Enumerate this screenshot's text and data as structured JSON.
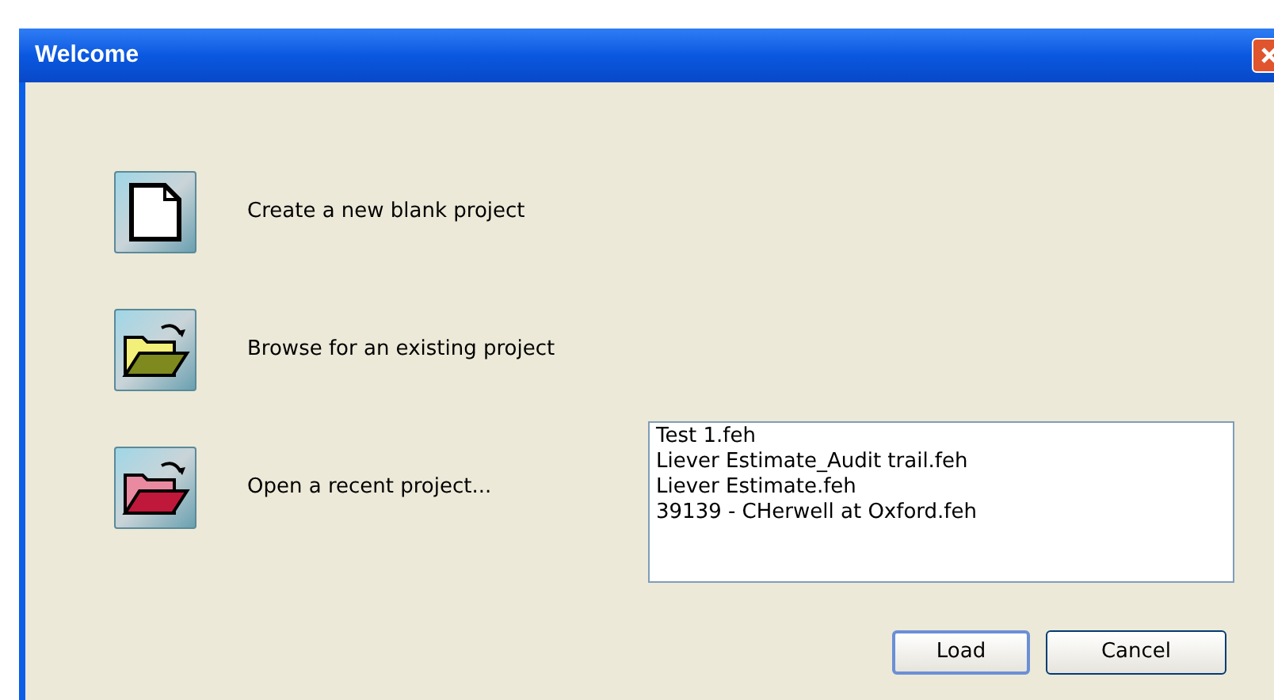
{
  "window": {
    "title": "Welcome"
  },
  "actions": [
    {
      "kind": "new",
      "label": "Create a new blank project"
    },
    {
      "kind": "browse",
      "label": "Browse for an existing project"
    },
    {
      "kind": "recent",
      "label": "Open a recent project..."
    }
  ],
  "recent_files": [
    "Test 1.feh",
    "Liever Estimate_Audit trail.feh",
    "Liever Estimate.feh",
    "39139 - CHerwell at Oxford.feh"
  ],
  "buttons": [
    {
      "label": "Load",
      "default": true
    },
    {
      "label": "Cancel",
      "default": false
    }
  ]
}
